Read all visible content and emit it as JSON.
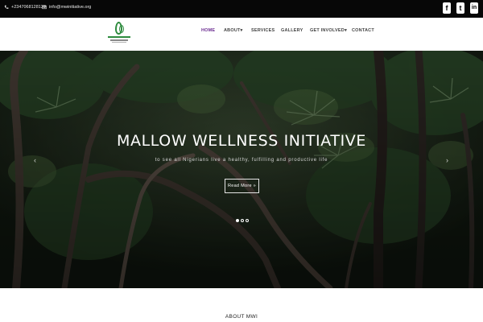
{
  "topbar": {
    "phone": "+2347068128128",
    "email": "info@mwinitiative.org",
    "social": [
      {
        "icon": "facebook-icon",
        "glyph": "f"
      },
      {
        "icon": "twitter-icon",
        "glyph": "t"
      },
      {
        "icon": "linkedin-icon",
        "glyph": "in"
      }
    ]
  },
  "nav": {
    "items": [
      "HOME",
      "ABOUT▾",
      "SERVICES",
      "GALLERY",
      "GET INVOLVED▾",
      "CONTACT"
    ],
    "active": "HOME"
  },
  "hero": {
    "title": "MALLOW WELLNESS INITIATIVE",
    "tagline": "to see all Nigerians live a healthy, fulfilling and productive life",
    "button": "Read More »",
    "prev_arrow": "‹",
    "next_arrow": "›",
    "slides": 3,
    "active_slide": 1
  },
  "about": {
    "heading": "ABOUT MWI"
  },
  "colors": {
    "topbar": "#070707",
    "accent": "#6b2c91",
    "logo_green": "#2e8b3e"
  }
}
